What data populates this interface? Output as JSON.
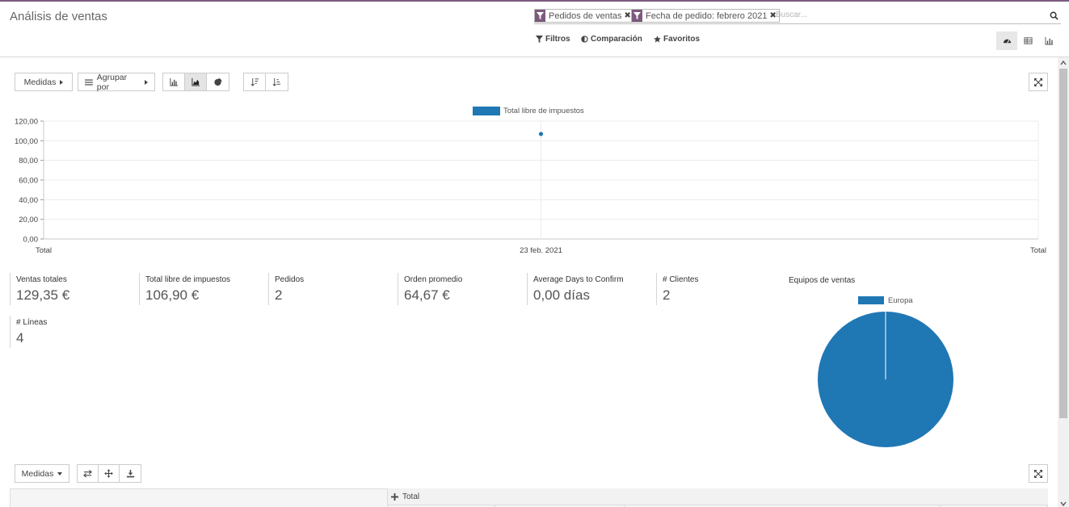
{
  "header": {
    "title": "Análisis de ventas",
    "facets": [
      {
        "label": "Pedidos de ventas",
        "icon": "filter-icon"
      },
      {
        "label": "Fecha de pedido: febrero 2021",
        "icon": "filter-icon"
      }
    ],
    "search_placeholder": "Buscar...",
    "filters_label": "Filtros",
    "comparison_label": "Comparación",
    "favorites_label": "Favoritos",
    "views": [
      "dashboard-icon",
      "pivot-icon",
      "graph-icon"
    ],
    "active_view": "dashboard"
  },
  "graph_toolbar": {
    "measures_label": "Medidas",
    "groupby_label": "Agrupar por",
    "chart_modes": [
      "bar-chart-icon",
      "line-chart-icon",
      "pie-chart-icon"
    ],
    "active_mode": "line",
    "sort": [
      "sort-desc-icon",
      "sort-asc-icon"
    ]
  },
  "chart_data": {
    "type": "line",
    "legend": [
      "Total libre de impuestos"
    ],
    "legend_position": "top-center",
    "x": [
      "Total",
      "23 feb. 2021",
      "Total"
    ],
    "series": [
      {
        "name": "Total libre de impuestos",
        "values": [
          null,
          106.9,
          null
        ],
        "color": "#1f77b4"
      }
    ],
    "yticks": [
      "0,00",
      "20,00",
      "40,00",
      "60,00",
      "80,00",
      "100,00",
      "120,00"
    ],
    "ylim": [
      0,
      120
    ],
    "grid": true
  },
  "kpis": [
    {
      "label": "Ventas totales",
      "value": "129,35 €"
    },
    {
      "label": "Total libre de impuestos",
      "value": "106,90 €"
    },
    {
      "label": "Pedidos",
      "value": "2"
    },
    {
      "label": "Orden promedio",
      "value": "64,67 €"
    },
    {
      "label": "Average Days to Confirm",
      "value": "0,00 días"
    },
    {
      "label": "# Clientes",
      "value": "2"
    },
    {
      "label": "# Líneas",
      "value": "4"
    }
  ],
  "pie": {
    "title": "Equipos de ventas",
    "legend": [
      "Europa"
    ],
    "slices": [
      {
        "label": "Europa",
        "value": 100,
        "color": "#1f77b4"
      }
    ]
  },
  "pivot": {
    "measures_label": "Medidas",
    "total_label": "Total"
  },
  "colors": {
    "brand": "#7c5a7e",
    "series": "#1f77b4"
  }
}
